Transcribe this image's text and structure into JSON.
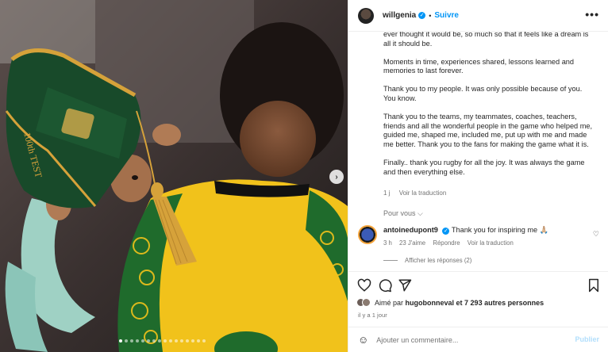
{
  "header": {
    "username": "willgenia",
    "separator": "•",
    "follow_label": "Suivre",
    "more_label": "•••"
  },
  "caption": {
    "paragraphs": [
      "ever thought it would be, so much so that it feels like a dream is all it should be.",
      "Moments in time, experiences shared, lessons learned and memories to last forever.",
      "Thank you to my people. It was only possible because of you. You know.",
      "Thank you to the teams, my teammates, coaches, teachers, friends and all the wonderful people in the game who helped me, guided me, shaped me, included me, put up with me and made me better. Thank you to the fans for making the game what it is.",
      "Finally.. thank you rugby for all the joy. It was always the game and then everything else."
    ],
    "time": "1 j",
    "translate_label": "Voir la traduction"
  },
  "pour_vous": "Pour vous ⌵",
  "comment": {
    "username": "antoinedupont9",
    "text": "Thank you for inspiring me 🙏🏼",
    "time": "3 h",
    "likes": "23 J'aime",
    "reply_label": "Répondre",
    "translate_label": "Voir la traduction",
    "view_replies": "Afficher les réponses (2)"
  },
  "likes": {
    "prefix": "Aimé par",
    "user": "hugobonneval",
    "suffix": "et 7 293 autres personnes"
  },
  "date": "il y a 1 jour",
  "add_comment": {
    "placeholder": "Ajouter un commentaire...",
    "publish_label": "Publier"
  },
  "media": {
    "cap_text": "100th TEST",
    "carousel_count": 16,
    "carousel_active_index": 0
  },
  "colors": {
    "link_blue": "#0095f6",
    "publish_disabled": "#b2dffc",
    "jersey_yellow": "#f1c21b",
    "jersey_green": "#1f6b2c",
    "cap_green": "#184a2a",
    "tassel_gold": "#d6a23a"
  }
}
